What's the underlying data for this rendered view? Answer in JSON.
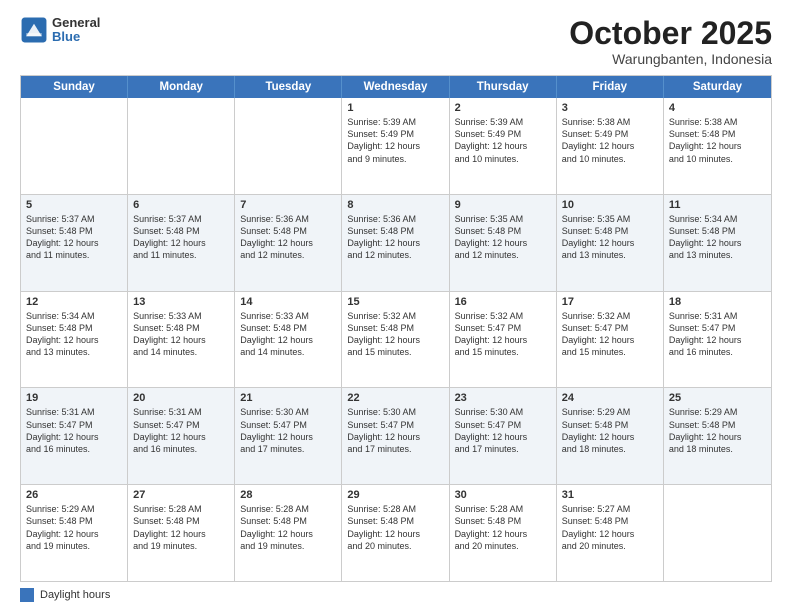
{
  "header": {
    "logo_general": "General",
    "logo_blue": "Blue",
    "title": "October 2025",
    "location": "Warungbanten, Indonesia"
  },
  "weekdays": [
    "Sunday",
    "Monday",
    "Tuesday",
    "Wednesday",
    "Thursday",
    "Friday",
    "Saturday"
  ],
  "weeks": [
    [
      {
        "day": "",
        "text": ""
      },
      {
        "day": "",
        "text": ""
      },
      {
        "day": "",
        "text": ""
      },
      {
        "day": "1",
        "text": "Sunrise: 5:39 AM\nSunset: 5:49 PM\nDaylight: 12 hours\nand 9 minutes."
      },
      {
        "day": "2",
        "text": "Sunrise: 5:39 AM\nSunset: 5:49 PM\nDaylight: 12 hours\nand 10 minutes."
      },
      {
        "day": "3",
        "text": "Sunrise: 5:38 AM\nSunset: 5:49 PM\nDaylight: 12 hours\nand 10 minutes."
      },
      {
        "day": "4",
        "text": "Sunrise: 5:38 AM\nSunset: 5:48 PM\nDaylight: 12 hours\nand 10 minutes."
      }
    ],
    [
      {
        "day": "5",
        "text": "Sunrise: 5:37 AM\nSunset: 5:48 PM\nDaylight: 12 hours\nand 11 minutes."
      },
      {
        "day": "6",
        "text": "Sunrise: 5:37 AM\nSunset: 5:48 PM\nDaylight: 12 hours\nand 11 minutes."
      },
      {
        "day": "7",
        "text": "Sunrise: 5:36 AM\nSunset: 5:48 PM\nDaylight: 12 hours\nand 12 minutes."
      },
      {
        "day": "8",
        "text": "Sunrise: 5:36 AM\nSunset: 5:48 PM\nDaylight: 12 hours\nand 12 minutes."
      },
      {
        "day": "9",
        "text": "Sunrise: 5:35 AM\nSunset: 5:48 PM\nDaylight: 12 hours\nand 12 minutes."
      },
      {
        "day": "10",
        "text": "Sunrise: 5:35 AM\nSunset: 5:48 PM\nDaylight: 12 hours\nand 13 minutes."
      },
      {
        "day": "11",
        "text": "Sunrise: 5:34 AM\nSunset: 5:48 PM\nDaylight: 12 hours\nand 13 minutes."
      }
    ],
    [
      {
        "day": "12",
        "text": "Sunrise: 5:34 AM\nSunset: 5:48 PM\nDaylight: 12 hours\nand 13 minutes."
      },
      {
        "day": "13",
        "text": "Sunrise: 5:33 AM\nSunset: 5:48 PM\nDaylight: 12 hours\nand 14 minutes."
      },
      {
        "day": "14",
        "text": "Sunrise: 5:33 AM\nSunset: 5:48 PM\nDaylight: 12 hours\nand 14 minutes."
      },
      {
        "day": "15",
        "text": "Sunrise: 5:32 AM\nSunset: 5:48 PM\nDaylight: 12 hours\nand 15 minutes."
      },
      {
        "day": "16",
        "text": "Sunrise: 5:32 AM\nSunset: 5:47 PM\nDaylight: 12 hours\nand 15 minutes."
      },
      {
        "day": "17",
        "text": "Sunrise: 5:32 AM\nSunset: 5:47 PM\nDaylight: 12 hours\nand 15 minutes."
      },
      {
        "day": "18",
        "text": "Sunrise: 5:31 AM\nSunset: 5:47 PM\nDaylight: 12 hours\nand 16 minutes."
      }
    ],
    [
      {
        "day": "19",
        "text": "Sunrise: 5:31 AM\nSunset: 5:47 PM\nDaylight: 12 hours\nand 16 minutes."
      },
      {
        "day": "20",
        "text": "Sunrise: 5:31 AM\nSunset: 5:47 PM\nDaylight: 12 hours\nand 16 minutes."
      },
      {
        "day": "21",
        "text": "Sunrise: 5:30 AM\nSunset: 5:47 PM\nDaylight: 12 hours\nand 17 minutes."
      },
      {
        "day": "22",
        "text": "Sunrise: 5:30 AM\nSunset: 5:47 PM\nDaylight: 12 hours\nand 17 minutes."
      },
      {
        "day": "23",
        "text": "Sunrise: 5:30 AM\nSunset: 5:47 PM\nDaylight: 12 hours\nand 17 minutes."
      },
      {
        "day": "24",
        "text": "Sunrise: 5:29 AM\nSunset: 5:48 PM\nDaylight: 12 hours\nand 18 minutes."
      },
      {
        "day": "25",
        "text": "Sunrise: 5:29 AM\nSunset: 5:48 PM\nDaylight: 12 hours\nand 18 minutes."
      }
    ],
    [
      {
        "day": "26",
        "text": "Sunrise: 5:29 AM\nSunset: 5:48 PM\nDaylight: 12 hours\nand 19 minutes."
      },
      {
        "day": "27",
        "text": "Sunrise: 5:28 AM\nSunset: 5:48 PM\nDaylight: 12 hours\nand 19 minutes."
      },
      {
        "day": "28",
        "text": "Sunrise: 5:28 AM\nSunset: 5:48 PM\nDaylight: 12 hours\nand 19 minutes."
      },
      {
        "day": "29",
        "text": "Sunrise: 5:28 AM\nSunset: 5:48 PM\nDaylight: 12 hours\nand 20 minutes."
      },
      {
        "day": "30",
        "text": "Sunrise: 5:28 AM\nSunset: 5:48 PM\nDaylight: 12 hours\nand 20 minutes."
      },
      {
        "day": "31",
        "text": "Sunrise: 5:27 AM\nSunset: 5:48 PM\nDaylight: 12 hours\nand 20 minutes."
      },
      {
        "day": "",
        "text": ""
      }
    ]
  ],
  "legend": {
    "label": "Daylight hours"
  }
}
